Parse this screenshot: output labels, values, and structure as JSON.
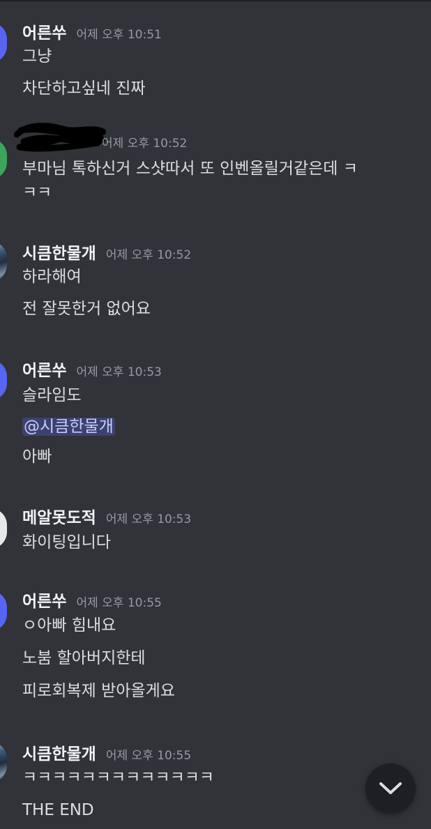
{
  "messages": [
    {
      "author": "어른쑤",
      "time": "어제 오후 10:51",
      "lines": [
        "그냥",
        "차단하고싶네 진짜"
      ]
    },
    {
      "author": "",
      "time": "어제 오후 10:52",
      "lines": [
        "부마님 톡하신거 스샷따서 또 인벤올릴거같은데 ㅋ",
        "ㅋㅋ"
      ]
    },
    {
      "author": "시큼한물개",
      "time": "어제 오후 10:52",
      "lines": [
        "하라해여",
        "전 잘못한거 없어요"
      ]
    },
    {
      "author": "어른쑤",
      "time": "어제 오후 10:53",
      "lines": [
        "슬라임도",
        "@시큼한물개",
        "아빠"
      ]
    },
    {
      "author": "메알못도적",
      "time": "어제 오후 10:53",
      "lines": [
        "화이팅입니다"
      ]
    },
    {
      "author": "어른쑤",
      "time": "어제 오후 10:55",
      "lines": [
        "ㅇ아빠 힘내요",
        "노붐 할아버지한테",
        "피로회복제 받아올게요"
      ]
    },
    {
      "author": "시큼한물개",
      "time": "어제 오후 10:55",
      "lines": [
        "ㅋㅋㅋㅋㅋㅋㅋㅋㅋㅋㅋㅋㅋ",
        "THE END"
      ]
    }
  ],
  "scroll_button": {
    "icon": "chevron-down-icon"
  },
  "colors": {
    "background": "#313338",
    "username": "#f2f3f5",
    "timestamp": "#949ba4",
    "mention_bg": "#3c4270",
    "mention_text": "#c9cdfb"
  }
}
